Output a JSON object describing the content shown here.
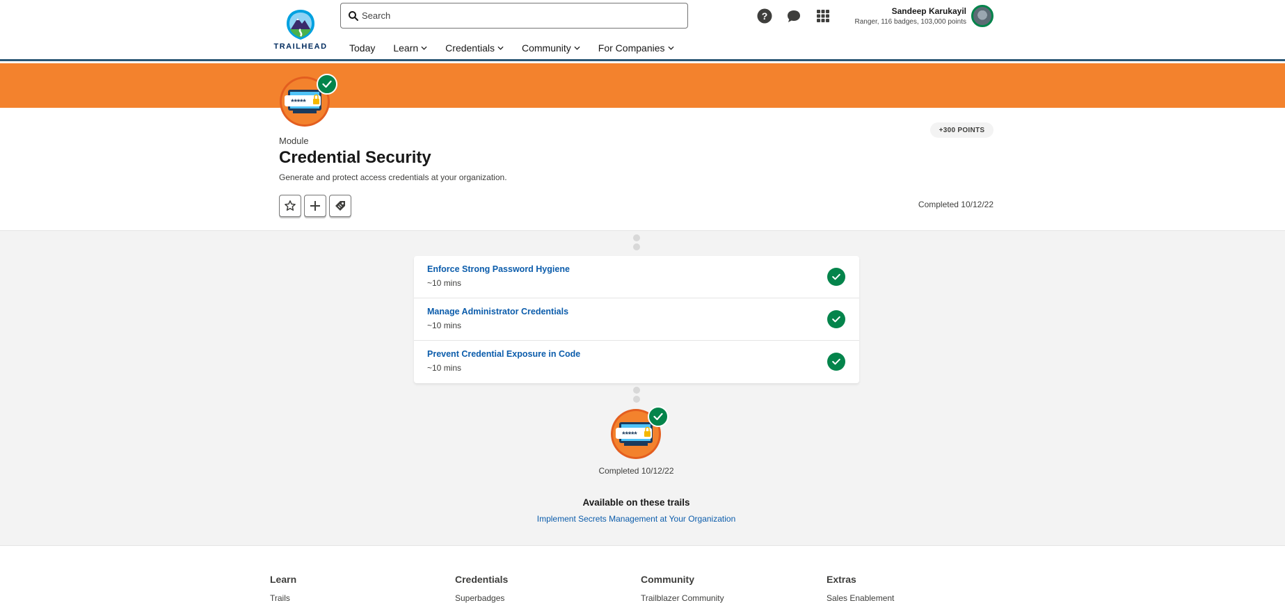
{
  "header": {
    "logo_text": "TRAILHEAD",
    "search_placeholder": "Search",
    "nav": [
      {
        "label": "Today",
        "dropdown": false
      },
      {
        "label": "Learn",
        "dropdown": true
      },
      {
        "label": "Credentials",
        "dropdown": true
      },
      {
        "label": "Community",
        "dropdown": true
      },
      {
        "label": "For Companies",
        "dropdown": true
      }
    ],
    "icons": [
      "help-icon",
      "chat-icon",
      "app-launcher-icon"
    ],
    "user": {
      "name": "Sandeep Karukayil",
      "meta": "Ranger, 116 badges, 103,000 points"
    }
  },
  "module": {
    "label": "Module",
    "title": "Credential Security",
    "description": "Generate and protect access credentials at your organization.",
    "points": "+300 POINTS",
    "completed": "Completed 10/12/22",
    "badge_text": "*****",
    "actions": [
      {
        "name": "favorite-button",
        "icon": "star-icon"
      },
      {
        "name": "add-to-collection-button",
        "icon": "plus-icon"
      },
      {
        "name": "tag-button",
        "icon": "tag-icon"
      }
    ]
  },
  "units": [
    {
      "title": "Enforce Strong Password Hygiene",
      "time": "~10 mins",
      "completed": true
    },
    {
      "title": "Manage Administrator Credentials",
      "time": "~10 mins",
      "completed": true
    },
    {
      "title": "Prevent Credential Exposure in Code",
      "time": "~10 mins",
      "completed": true
    }
  ],
  "badge_completion": {
    "completed": "Completed 10/12/22",
    "badge_text": "*****"
  },
  "trails": {
    "heading": "Available on these trails",
    "links": [
      "Implement Secrets Management at Your Organization"
    ]
  },
  "footer": {
    "columns": [
      {
        "heading": "Learn",
        "first_link": "Trails"
      },
      {
        "heading": "Credentials",
        "first_link": "Superbadges"
      },
      {
        "heading": "Community",
        "first_link": "Trailblazer Community"
      },
      {
        "heading": "Extras",
        "first_link": "Sales Enablement"
      }
    ]
  },
  "colors": {
    "banner": "#f3822d",
    "success": "#04844b",
    "link": "#0b5cab",
    "brand_dark": "#032d60"
  }
}
